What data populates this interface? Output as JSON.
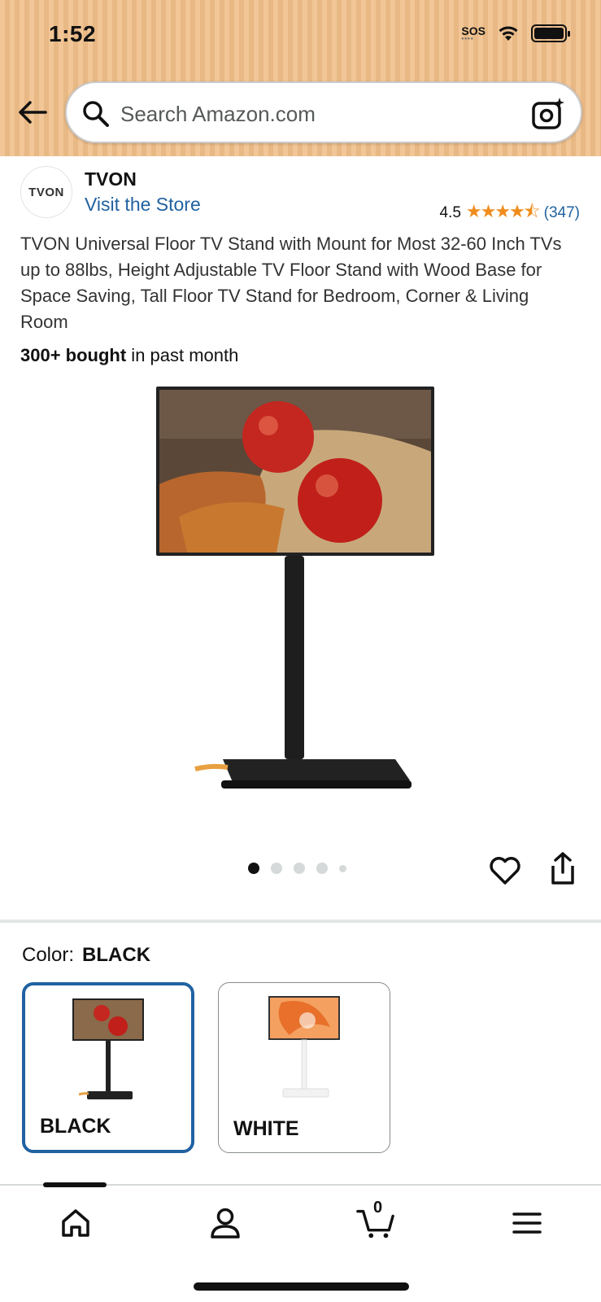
{
  "status_bar": {
    "time": "1:52",
    "sos": "SOS"
  },
  "header": {
    "search_placeholder": "Search Amazon.com"
  },
  "brand": {
    "logo_text": "TVON",
    "name": "TVON",
    "store_link": "Visit the Store"
  },
  "rating": {
    "value": "4.5",
    "stars": "★★★★⯪",
    "count": "(347)"
  },
  "product": {
    "title": "TVON Universal Floor TV Stand with Mount for Most 32-60 Inch TVs up to 88lbs, Height Adjustable TV Floor Stand with Wood Base for Space Saving, Tall Floor TV Stand for Bedroom, Corner & Living Room",
    "bought_bold": "300+ bought",
    "bought_rest": " in past month"
  },
  "carousel": {
    "total": 5,
    "active_index": 0
  },
  "color": {
    "label": "Color:",
    "selected": "BLACK",
    "options": [
      "BLACK",
      "WHITE"
    ]
  },
  "bottom_nav": {
    "cart_count": "0"
  },
  "colors": {
    "header_bg": "#f1c08a",
    "link": "#2162a1",
    "star": "#f08c1c",
    "selected_border": "#2162a1"
  },
  "icons": [
    "back-arrow-icon",
    "search-icon",
    "camera-icon",
    "heart-icon",
    "share-icon",
    "home-icon",
    "account-icon",
    "cart-icon",
    "menu-icon"
  ]
}
